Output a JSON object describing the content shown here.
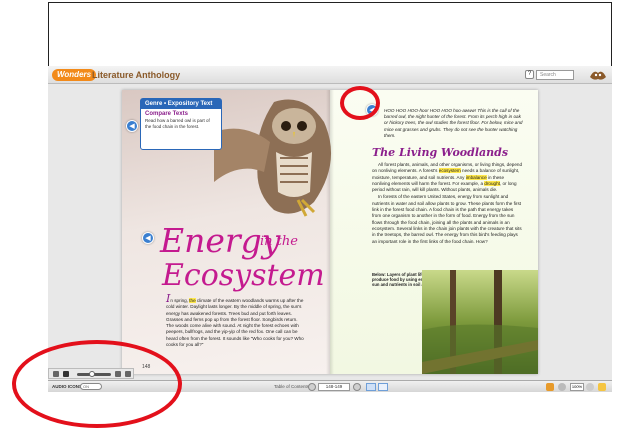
{
  "app": {
    "logo_text": "Wonders",
    "title": "Literature Anthology",
    "help_label": "?",
    "search_placeholder": "Search"
  },
  "left_page": {
    "genre_label": "Genre • Expository Text",
    "compare_title": "Compare Texts",
    "compare_body": "Read how a barred owl is part of the food chain in the forest.",
    "title_line1": "Energy",
    "title_in_the": "in the",
    "title_line2": "Ecosystem",
    "drop_cap": "I",
    "body_pre": "n spring, ",
    "body_hl": "the",
    "body_post": " climate of the eastern woodlands warms up after the cold winter. Daylight lasts longer. By the middle of spring, the sun's energy has awakened forests. Trees bud and put forth leaves. Grasses and ferns pop up from the forest floor. Songbirds return. The woods come alive with sound. At night the forest echoes with peepers, bullfrogs, and the yip-yip of the red fox. One call can be heard often from the forest. It sounds like \"Who cooks for you? Who cooks for you all?\"",
    "page_number": "148"
  },
  "right_page": {
    "intro": "HOO HOO HOO-hoo! HOO HOO hoo-awww! This is the call of the barred owl, the night hunter of the forest. From its perch high in oak or hickory trees, the owl studies the forest floor. For below, mice and mice eat grasses and grubs. They do not see the hunter watching them.",
    "section_title": "The Living Woodlands",
    "p1_a": "All forest plants, animals, and other organisms, or living things, depend on nonliving elements. A forest's ",
    "p1_hl": "ecosystem",
    "p1_b": " needs a balance of sunlight, moisture, temperature, and soil nutrients. Any ",
    "p1_hl2": "imbalance",
    "p1_c": " in these nonliving elements will harm the forest. For example, a ",
    "p1_hl3": "drought",
    "p1_d": ", or long period without rain, will kill plants. Without plants, animals die.",
    "p2": "In forests of the eastern United States, energy from sunlight and nutrients in water and soil allow plants to grow. These plants form the first link in the forest food chain. A food chain is the path that energy takes from one organism to another in the form of food. Energy from the sun flows through the food chain, joining all the plants and animals in an ecosystem. Several links in the chain join plants with the creature that sits in the treetops, the barred owl. The energy from this bird's feeding plays an important role in the first links of the food chain. How?",
    "caption": "Below: Layers of plant life in a forest produce food by using energy from the sun and nutrients in soil and water."
  },
  "toolbar": {
    "audio_icons_label": "AUDIO ICONS",
    "toggle_label": "ON",
    "toc_label": "Table of Contents",
    "page_field": "148-149",
    "zoom_value": "100%"
  },
  "colors": {
    "accent": "#c41a8f",
    "genre_blue": "#2a67b8",
    "annotation_red": "#e3101b"
  }
}
